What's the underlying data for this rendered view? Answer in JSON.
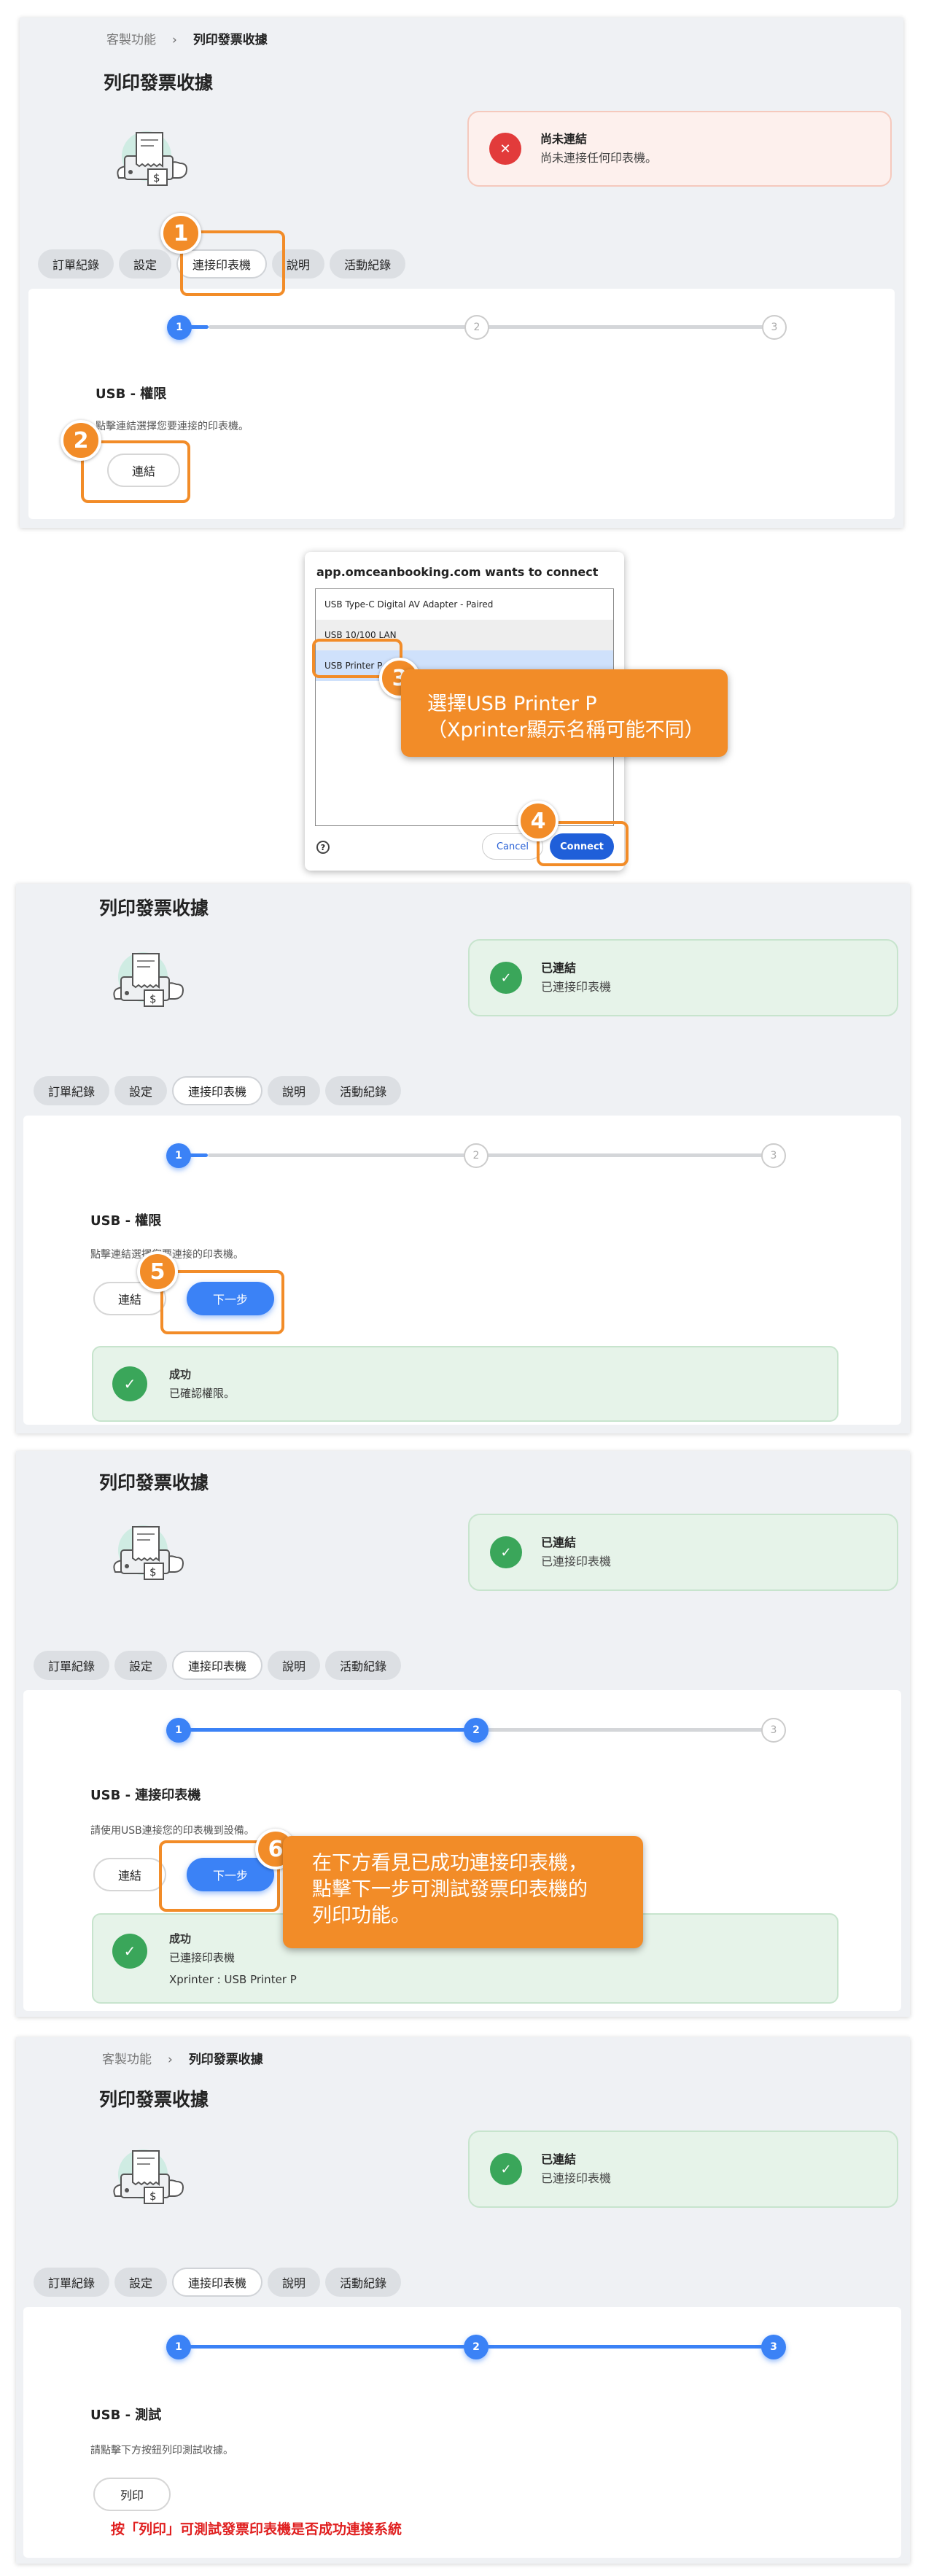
{
  "breadcrumb": {
    "parent": "客製功能",
    "current": "列印發票收據"
  },
  "page_title": "列印發票收據",
  "tabs": [
    "訂單紀錄",
    "設定",
    "連接印表機",
    "說明",
    "活動紀錄"
  ],
  "status_disconnected": {
    "title": "尚未連結",
    "desc": "尚未連接任何印表機。"
  },
  "status_connected": {
    "title": "已連結",
    "desc": "已連接印表機"
  },
  "steps": [
    "1",
    "2",
    "3"
  ],
  "usb_permission": {
    "title": "USB - 權限",
    "desc": "點擊連結選擇您要連接的印表機。"
  },
  "usb_connect": {
    "title": "USB - 連接印表機",
    "desc": "請使用USB連接您的印表機到設備。"
  },
  "usb_test": {
    "title": "USB - 測試",
    "desc": "請點擊下方按鈕列印測試收據。"
  },
  "buttons": {
    "connect": "連結",
    "next": "下一步",
    "print": "列印"
  },
  "success_permission": {
    "title": "成功",
    "desc": "已確認權限。"
  },
  "success_printer": {
    "title": "成功",
    "desc": "已連接印表機",
    "device": "Xprinter : USB Printer P"
  },
  "dialog": {
    "header": "app.omceanbooking.com wants to connect",
    "items": [
      "USB Type-C Digital AV Adapter - Paired",
      "USB 10/100 LAN",
      "USB Printer P"
    ],
    "help": "?",
    "cancel": "Cancel",
    "connect": "Connect"
  },
  "callouts": {
    "c3_line1": "選擇USB Printer P",
    "c3_line2": "（Xprinter顯示名稱可能不同）",
    "c6_line1": "在下方看見已成功連接印表機，",
    "c6_line2": "點擊下一步可測試發票印表機的",
    "c6_line3": "列印功能。"
  },
  "badges": [
    "1",
    "2",
    "3",
    "4",
    "5",
    "6"
  ],
  "note": "按「列印」可測試發票印表機是否成功連接系統",
  "colors": {
    "accent": "#3b82f6",
    "highlight": "#f28c28",
    "success": "#3aa65a",
    "error": "#e23b3b",
    "note": "#e02020"
  }
}
